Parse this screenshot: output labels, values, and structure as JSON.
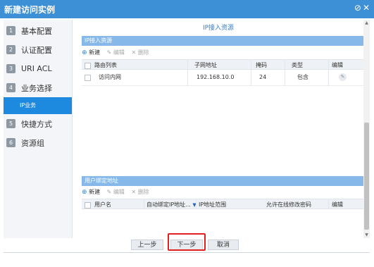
{
  "window": {
    "title": "新建访问实例",
    "help_icon": "help-circle-icon",
    "close_icon": "close-icon"
  },
  "sidebar": {
    "steps": [
      {
        "num": "1",
        "label": "基本配置"
      },
      {
        "num": "2",
        "label": "认证配置"
      },
      {
        "num": "3",
        "label": "URI ACL"
      },
      {
        "num": "4",
        "label": "业务选择"
      },
      {
        "num": "5",
        "label": "快捷方式"
      },
      {
        "num": "6",
        "label": "资源组"
      }
    ],
    "active_sub": "IP业务"
  },
  "main": {
    "section_title": "IP接入资源",
    "ip_panel": {
      "header": "IP接入资源",
      "toolbar": {
        "new": "新建",
        "edit": "编辑",
        "delete": "删除"
      },
      "columns": [
        "路由列表",
        "子网地址",
        "掩码",
        "类型",
        "编辑"
      ],
      "rows": [
        {
          "name": "访问内网",
          "subnet": "192.168.10.0",
          "mask": "24",
          "type": "包含"
        }
      ]
    },
    "user_panel": {
      "header": "用户绑定地址",
      "toolbar": {
        "new": "新建",
        "edit": "编辑",
        "delete": "删除"
      },
      "columns": [
        "用户名",
        "自动绑定IP地址...",
        "IP地址范围",
        "允许在线修改密码",
        "编辑"
      ]
    }
  },
  "footer": {
    "prev": "上一步",
    "next": "下一步",
    "cancel": "取消"
  },
  "colors": {
    "titlebar": "#3d8fd6",
    "accent": "#1d8ae0",
    "panel_header": "#86b8ea",
    "highlight": "#e02020"
  }
}
